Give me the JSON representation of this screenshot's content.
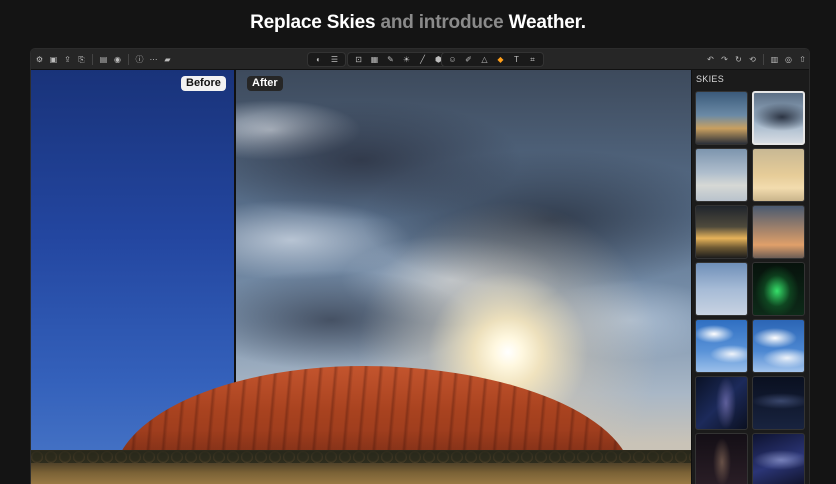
{
  "headline": {
    "part1": "Replace Skies",
    "part2": "and introduce",
    "part3": "Weather."
  },
  "canvas": {
    "before_label": "Before",
    "after_label": "After"
  },
  "toolbar": {
    "left_icons": [
      "gear-icon",
      "square-icon",
      "share-icon",
      "share-alt-icon",
      "document-icon",
      "layers-icon",
      "info-icon",
      "more-icon",
      "histogram-icon"
    ],
    "center_icons_a": [
      "compare-icon",
      "adjust-icon"
    ],
    "center_icons_b": [
      "crop-icon",
      "image-icon",
      "eyedropper-icon",
      "light-icon",
      "brush-icon",
      "box-icon"
    ],
    "center_icons_c": [
      "face-icon",
      "retouch-icon",
      "triangle-icon",
      "layers-accent-icon",
      "text-icon",
      "transform-icon"
    ],
    "right_icons": [
      "undo-icon",
      "redo-icon",
      "refresh-icon",
      "history-icon",
      "panel-icon",
      "mask-icon",
      "export-icon"
    ],
    "accent_color": "#ff9f1a"
  },
  "panel": {
    "title": "SKIES",
    "selected_index": 1,
    "thumbnails": [
      "sky-thumb-1",
      "sky-thumb-2",
      "sky-thumb-3",
      "sky-thumb-4",
      "sky-thumb-5",
      "sky-thumb-6",
      "sky-thumb-7",
      "sky-thumb-8",
      "sky-thumb-9",
      "sky-thumb-10",
      "sky-thumb-11",
      "sky-thumb-12",
      "sky-thumb-13",
      "sky-thumb-14"
    ]
  }
}
